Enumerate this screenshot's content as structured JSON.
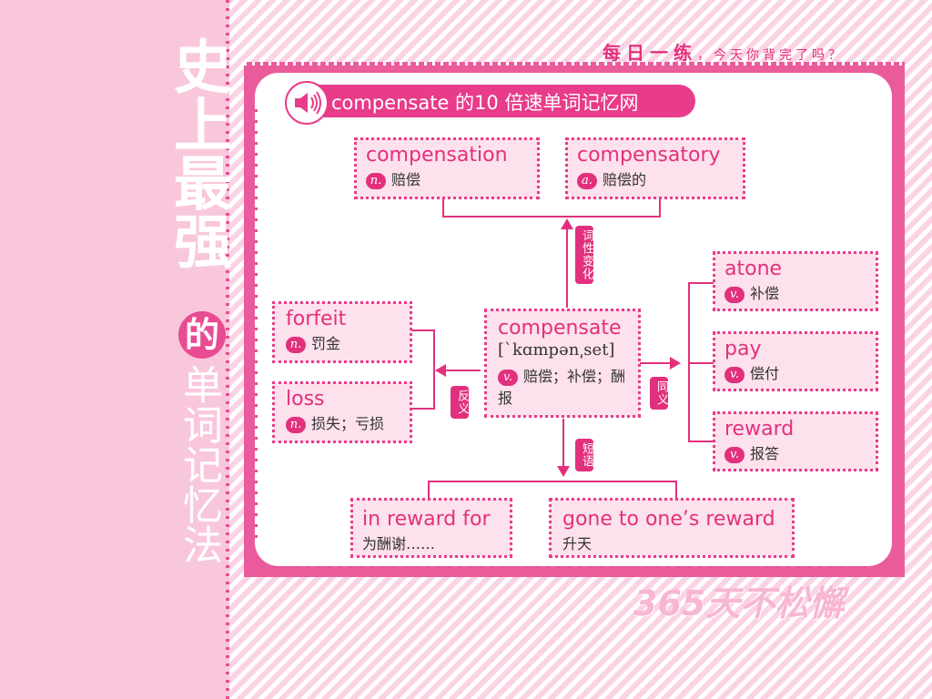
{
  "side_title": {
    "top": "史上最强",
    "de": "的",
    "bottom": "单词记忆法"
  },
  "slogan": {
    "main": "每日一练",
    "sub": "，今天你背完了吗？"
  },
  "header": "compensate 的10 倍速单词记忆网",
  "center": {
    "word": "compensate",
    "phonetic": "[ˋkɑmpən͵set]",
    "pos": "v.",
    "definition": "赔偿；补偿；酬报"
  },
  "derived": [
    {
      "word": "compensation",
      "pos": "n.",
      "definition": "赔偿"
    },
    {
      "word": "compensatory",
      "pos": "a.",
      "definition": "赔偿的"
    }
  ],
  "antonyms": [
    {
      "word": "forfeit",
      "pos": "n.",
      "definition": "罚金"
    },
    {
      "word": "loss",
      "pos": "n.",
      "definition": "损失；亏损"
    }
  ],
  "synonyms": [
    {
      "word": "atone",
      "pos": "v.",
      "definition": "补偿"
    },
    {
      "word": "pay",
      "pos": "v.",
      "definition": "偿付"
    },
    {
      "word": "reward",
      "pos": "v.",
      "definition": "报答"
    }
  ],
  "phrases": [
    {
      "phrase": "in reward for",
      "definition": "为酬谢……"
    },
    {
      "phrase": "gone to one’s reward",
      "definition": "升天"
    }
  ],
  "labels": {
    "derivation": "词性变化",
    "antonym": "反义",
    "synonym": "同义",
    "phrase": "短语"
  },
  "motto": "365天不松懈",
  "colors": {
    "accent": "#e2307e",
    "frame": "#ea5b9c",
    "box_fill": "#fde1ec",
    "side": "#f9c7dc"
  },
  "icons": [
    "speaker-icon"
  ]
}
